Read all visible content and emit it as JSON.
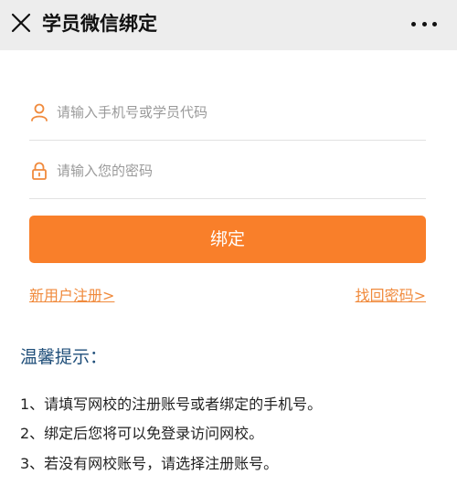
{
  "header": {
    "title": "学员微信绑定",
    "close_icon": "close-icon",
    "more_icon": "more-dots-icon"
  },
  "form": {
    "account_placeholder": "请输入手机号或学员代码",
    "account_icon": "user-icon",
    "password_placeholder": "请输入您的密码",
    "password_icon": "lock-icon",
    "bind_label": "绑定",
    "register_link": "新用户注册>",
    "forgot_link": "找回密码>"
  },
  "tips": {
    "title": "温馨提示：",
    "items": [
      "1、请填写网校的注册账号或者绑定的手机号。",
      "2、绑定后您将可以免登录访问网校。",
      "3、若没有网校账号，请选择注册账号。"
    ]
  },
  "colors": {
    "accent": "#f97f2a",
    "link": "#f08a3c",
    "tips_title": "#1f4e79",
    "header_bg": "#ededed"
  }
}
